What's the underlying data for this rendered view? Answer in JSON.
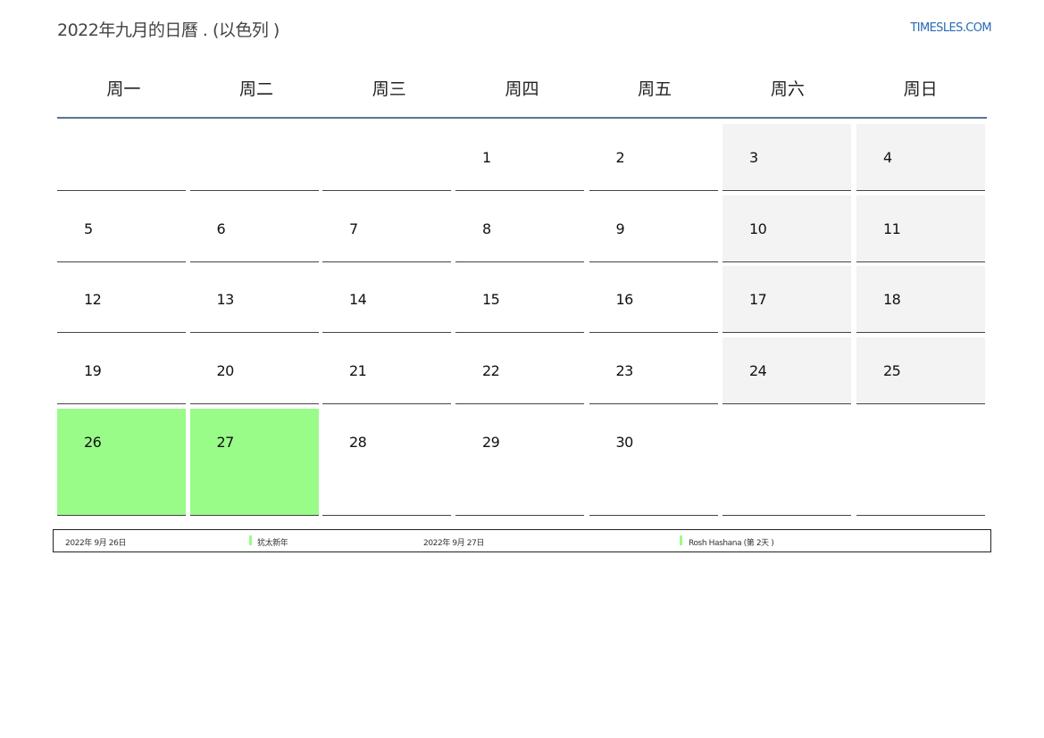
{
  "header": {
    "title": "2022年九月的日曆 . (以色列 )",
    "site": "TIMESLES.COM"
  },
  "weekdays": [
    "周一",
    "周二",
    "周三",
    "周四",
    "周五",
    "周六",
    "周日"
  ],
  "weeks": [
    [
      "",
      "",
      "",
      "1",
      "2",
      "3",
      "4"
    ],
    [
      "5",
      "6",
      "7",
      "8",
      "9",
      "10",
      "11"
    ],
    [
      "12",
      "13",
      "14",
      "15",
      "16",
      "17",
      "18"
    ],
    [
      "19",
      "20",
      "21",
      "22",
      "23",
      "24",
      "25"
    ],
    [
      "26",
      "27",
      "28",
      "29",
      "30",
      "",
      ""
    ]
  ],
  "holidays": [
    "26",
    "27"
  ],
  "colors": {
    "holiday": "#99fb88",
    "weekend": "#f3f3f3",
    "header_rule": "#5b7393",
    "link": "#2a6ab4"
  },
  "legend": [
    {
      "date": "2022年 9月 26日",
      "name": "犹太新年"
    },
    {
      "date": "2022年 9月 27日",
      "name": "Rosh Hashana (第 2天 )"
    }
  ]
}
